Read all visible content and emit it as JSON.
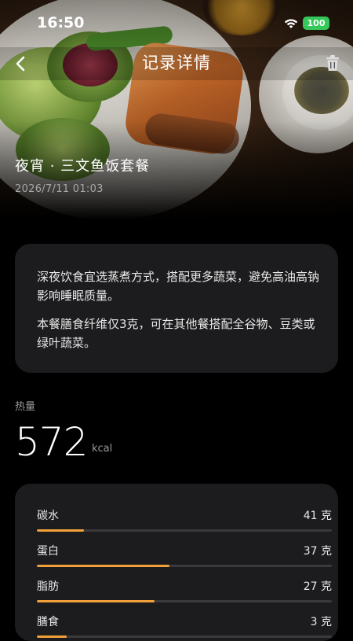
{
  "status_bar": {
    "time": "16:50",
    "battery": "100"
  },
  "nav": {
    "title": "记录详情"
  },
  "meal": {
    "name": "夜宵 · 三文鱼饭套餐",
    "datetime": "2026/7/11 01:03"
  },
  "advice": [
    "深夜饮食宜选蒸煮方式，搭配更多蔬菜，避免高油高钠影响睡眠质量。",
    "本餐膳食纤维仅3克，可在其他餐搭配全谷物、豆类或绿叶蔬菜。"
  ],
  "calories": {
    "label": "热量",
    "value": "572",
    "unit": "kcal"
  },
  "nutrients": [
    {
      "name": "碳水",
      "amount": "41 克",
      "progress": 0.16
    },
    {
      "name": "蛋白",
      "amount": "37 克",
      "progress": 0.45
    },
    {
      "name": "脂肪",
      "amount": "27 克",
      "progress": 0.4
    },
    {
      "name": "膳食",
      "amount": "3 克",
      "progress": 0.1
    }
  ],
  "colors": {
    "accent": "#f2a03a",
    "card": "#1c1c1e",
    "battery": "#34c759"
  },
  "icons": {
    "back": "chevron-left-icon",
    "delete": "trash-icon",
    "wifi": "wifi-icon"
  }
}
